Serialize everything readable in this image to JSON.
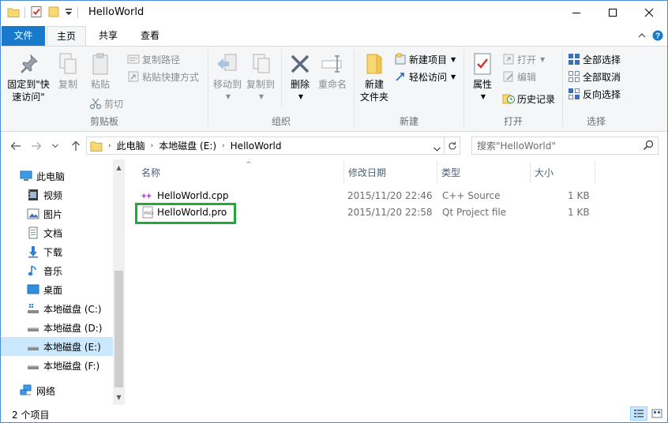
{
  "window": {
    "title": "HelloWorld"
  },
  "ribbon_tabs": {
    "file": "文件",
    "home": "主页",
    "share": "共享",
    "view": "查看"
  },
  "ribbon": {
    "clipboard": {
      "label": "剪贴板",
      "pin_line1": "固定到\"快",
      "pin_line2": "速访问\"",
      "copy": "复制",
      "paste": "粘贴",
      "copy_path": "复制路径",
      "paste_shortcut": "粘贴快捷方式",
      "cut": "剪切"
    },
    "organize": {
      "label": "组织",
      "move_to": "移动到",
      "copy_to": "复制到",
      "delete": "删除",
      "rename": "重命名"
    },
    "new": {
      "label": "新建",
      "new_folder_line1": "新建",
      "new_folder_line2": "文件夹",
      "new_item": "新建项目",
      "easy_access": "轻松访问"
    },
    "open": {
      "label": "打开",
      "properties": "属性",
      "open": "打开",
      "edit": "编辑",
      "history": "历史记录"
    },
    "select": {
      "label": "选择",
      "select_all": "全部选择",
      "select_none": "全部取消",
      "invert": "反向选择"
    }
  },
  "address": {
    "segments": [
      "此电脑",
      "本地磁盘 (E:)",
      "HelloWorld"
    ],
    "search_placeholder": "搜索\"HelloWorld\""
  },
  "nav_pane": {
    "items": [
      {
        "label": "此电脑",
        "icon": "computer-icon"
      },
      {
        "label": "视频",
        "icon": "video-icon"
      },
      {
        "label": "图片",
        "icon": "pictures-icon"
      },
      {
        "label": "文档",
        "icon": "documents-icon"
      },
      {
        "label": "下载",
        "icon": "download-icon"
      },
      {
        "label": "音乐",
        "icon": "music-icon"
      },
      {
        "label": "桌面",
        "icon": "desktop-icon"
      },
      {
        "label": "本地磁盘 (C:)",
        "icon": "drive-icon"
      },
      {
        "label": "本地磁盘 (D:)",
        "icon": "drive-icon"
      },
      {
        "label": "本地磁盘 (E:)",
        "icon": "drive-icon"
      },
      {
        "label": "本地磁盘 (F:)",
        "icon": "drive-icon"
      },
      {
        "label": "网络",
        "icon": "network-icon"
      }
    ],
    "selected": "本地磁盘 (E:)"
  },
  "file_list": {
    "columns": {
      "name": "名称",
      "modified": "修改日期",
      "type": "类型",
      "size": "大小"
    },
    "rows": [
      {
        "name": "HelloWorld.cpp",
        "modified": "2015/11/20 22:46",
        "type": "C++ Source",
        "size": "1 KB",
        "icon": "cpp-file-icon"
      },
      {
        "name": "HelloWorld.pro",
        "modified": "2015/11/20 22:58",
        "type": "Qt Project file",
        "size": "1 KB",
        "icon": "pro-file-icon"
      }
    ]
  },
  "status": {
    "item_count": "2 个项目"
  },
  "colors": {
    "accent": "#1979ca",
    "selection": "#cce8ff",
    "highlight_box": "#22a83a"
  }
}
